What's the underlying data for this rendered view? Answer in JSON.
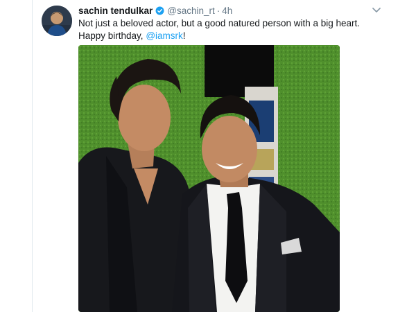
{
  "tweet": {
    "author_name": "sachin tendulkar",
    "handle": "@sachin_rt",
    "separator": "·",
    "time": "4h",
    "text_main": "Not just a beloved actor, but a good natured person with a big heart. Happy birthday, ",
    "mention": "@iamsrk",
    "text_end": "!"
  },
  "icons": {
    "verified": "verified-badge-icon",
    "more": "chevron-down-icon"
  },
  "colors": {
    "link": "#1da1f2",
    "secondary_text": "#657786",
    "primary_text": "#14171a",
    "wall_green": "#4f8f2c"
  }
}
